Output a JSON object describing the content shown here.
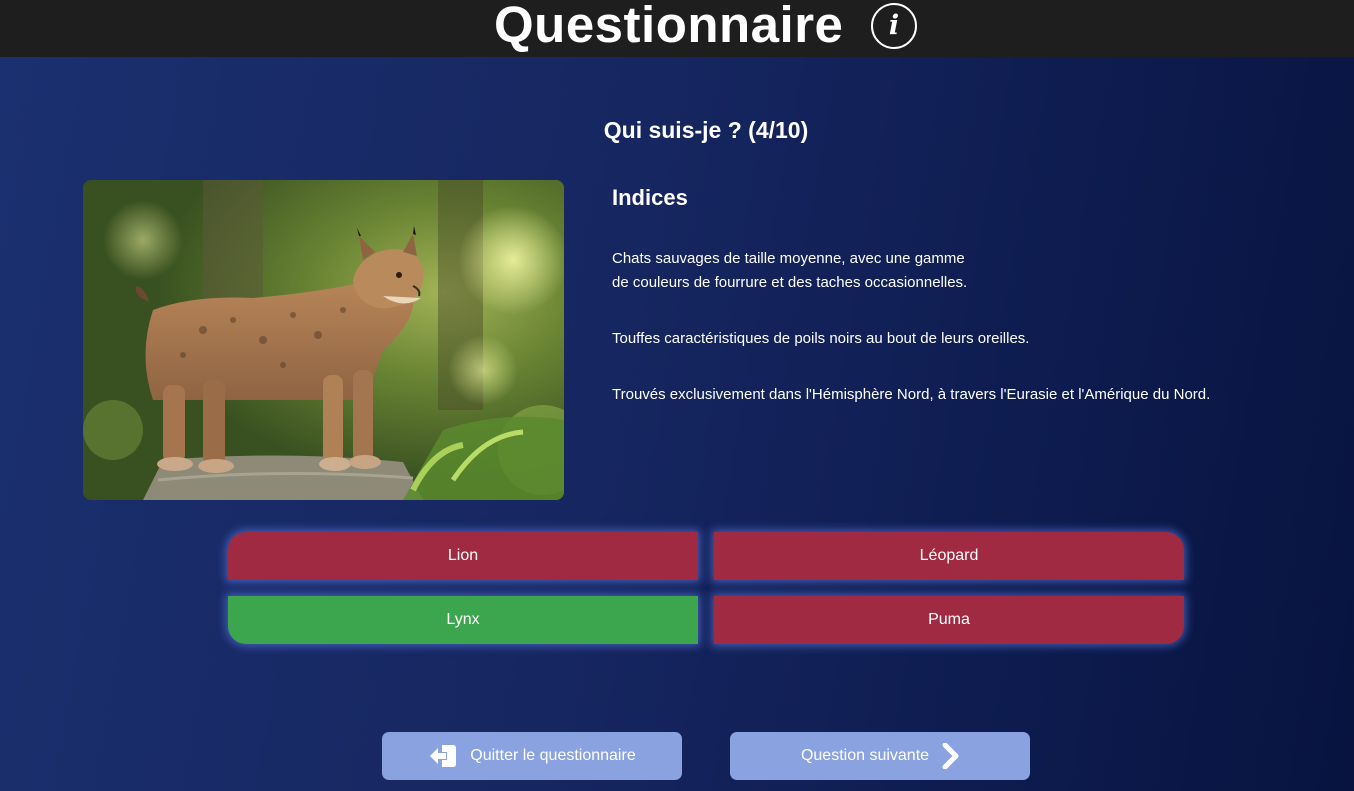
{
  "header": {
    "title": "Questionnaire",
    "info_icon": "info-icon",
    "info_glyph": "i"
  },
  "question": {
    "title": "Qui suis-je ? (4/10)",
    "image_subject": "lynx-photo"
  },
  "hints": {
    "heading": "Indices",
    "items": [
      "Chats sauvages de taille moyenne, avec une gamme\nde couleurs de fourrure et des taches occasionnelles.",
      "Touffes caractéristiques de poils noirs au bout de leurs oreilles.",
      "Trouvés exclusivement dans l'Hémisphère Nord, à travers l'Eurasie et l'Amérique du Nord."
    ]
  },
  "answers": [
    {
      "label": "Lion",
      "state": "wrong"
    },
    {
      "label": "Léopard",
      "state": "wrong"
    },
    {
      "label": "Lynx",
      "state": "correct"
    },
    {
      "label": "Puma",
      "state": "wrong"
    }
  ],
  "footer": {
    "quit_label": "Quitter le questionnaire",
    "quit_icon": "exit-icon",
    "next_label": "Question suivante",
    "next_icon": "chevron-right-icon"
  },
  "colors": {
    "topbar": "#1e1e1e",
    "wrong_answer": "#a02a42",
    "correct_answer": "#3ca64f",
    "nav_button": "#8ba2e0",
    "background": "#162660"
  }
}
